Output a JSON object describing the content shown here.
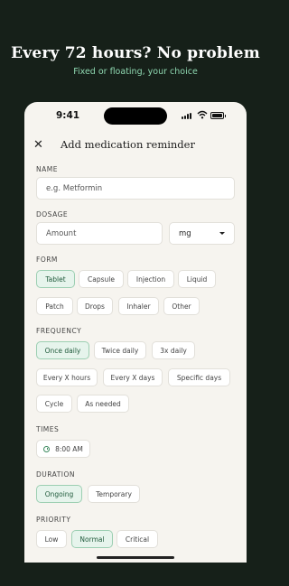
{
  "promo": {
    "title": "Every 72 hours? No problem",
    "subtitle": "Fixed or floating, your choice"
  },
  "status_bar": {
    "time": "9:41"
  },
  "header": {
    "close_icon": "close-icon",
    "title": "Add medication reminder"
  },
  "name": {
    "label": "NAME",
    "placeholder": "e.g. Metformin"
  },
  "dosage": {
    "label": "DOSAGE",
    "amount_placeholder": "Amount",
    "unit_selected": "mg"
  },
  "form": {
    "label": "FORM",
    "options": [
      "Tablet",
      "Capsule",
      "Injection",
      "Liquid",
      "Patch",
      "Drops",
      "Inhaler",
      "Other"
    ],
    "selected": "Tablet"
  },
  "frequency": {
    "label": "FREQUENCY",
    "options": [
      "Once daily",
      "Twice daily",
      "3x daily",
      "Every X hours",
      "Every X days",
      "Specific days",
      "Cycle",
      "As needed"
    ],
    "selected": "Once daily"
  },
  "times": {
    "label": "TIMES",
    "values": [
      "8:00 AM"
    ]
  },
  "duration": {
    "label": "DURATION",
    "options": [
      "Ongoing",
      "Temporary"
    ],
    "selected": "Ongoing"
  },
  "priority": {
    "label": "PRIORITY",
    "options": [
      "Low",
      "Normal",
      "Critical"
    ],
    "selected": "Normal"
  },
  "colors": {
    "background": "#162019",
    "accent": "#8fd8b1",
    "selected_chip": "#e6f4ec",
    "selected_border": "#9ccfb2",
    "screen": "#f6f4ef"
  }
}
